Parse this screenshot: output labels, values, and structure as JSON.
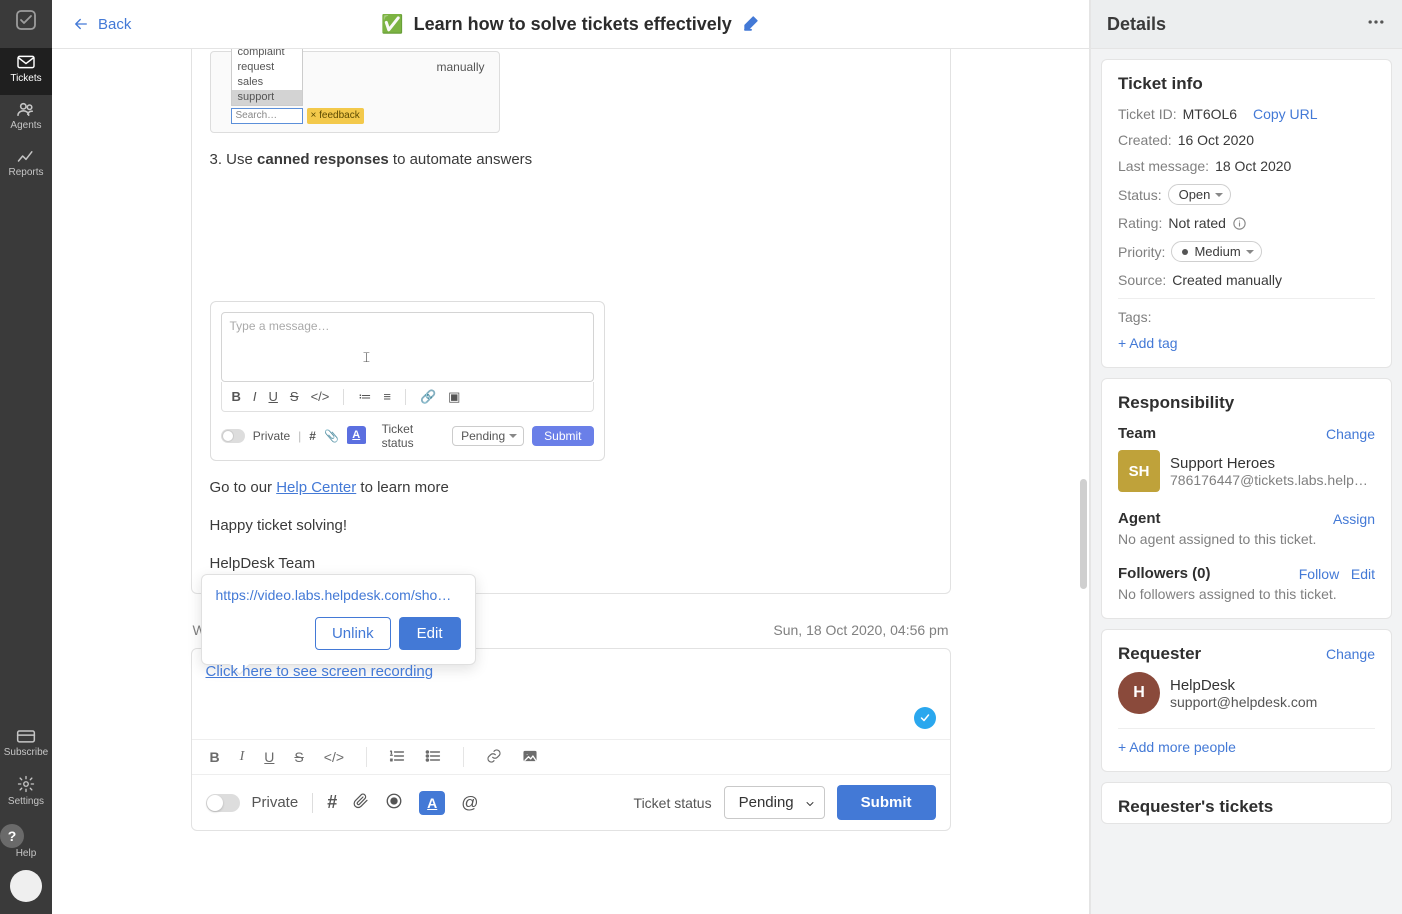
{
  "sidebar": {
    "items": [
      {
        "label": "Tickets"
      },
      {
        "label": "Agents"
      },
      {
        "label": "Reports"
      }
    ],
    "bottom": [
      {
        "label": "Subscribe"
      },
      {
        "label": "Settings"
      },
      {
        "label": "Help"
      }
    ]
  },
  "topbar": {
    "back": "Back",
    "title_emoji": "✅",
    "title": "Learn how to solve tickets effectively"
  },
  "message": {
    "shot1": {
      "opts": [
        "complaint",
        "request",
        "sales",
        "support"
      ],
      "manual": "manually",
      "search_ph": "Search…",
      "tag": "feedback"
    },
    "step3_prefix": "3. Use ",
    "step3_bold": "canned responses",
    "step3_suffix": " to automate answers",
    "shot2": {
      "placeholder": "Type a message…",
      "private": "Private",
      "status_lbl": "Ticket status",
      "status_val": "Pending",
      "submit": "Submit"
    },
    "goto_prefix": "Go to our ",
    "help_center": "Help Center",
    "goto_suffix": " to learn more",
    "happy": "Happy ticket solving!",
    "sig": "HelpDesk Team"
  },
  "meta": {
    "from": "Wer",
    "date": "Sun, 18 Oct 2020, 04:56 pm"
  },
  "popover": {
    "url": "https://video.labs.helpdesk.com/show/...",
    "unlink": "Unlink",
    "edit": "Edit"
  },
  "composer": {
    "link_text": "Click here to see screen recording",
    "private": "Private",
    "status_lbl": "Ticket status",
    "status_val": "Pending",
    "submit": "Submit"
  },
  "details": {
    "header": "Details",
    "info": {
      "title": "Ticket info",
      "id_lbl": "Ticket ID:",
      "id_val": "MT6OL6",
      "copy": "Copy URL",
      "created_lbl": "Created:",
      "created_val": "16 Oct 2020",
      "last_lbl": "Last message:",
      "last_val": "18 Oct 2020",
      "status_lbl": "Status:",
      "status_val": "Open",
      "rating_lbl": "Rating:",
      "rating_val": "Not rated",
      "priority_lbl": "Priority:",
      "priority_val": "Medium",
      "source_lbl": "Source:",
      "source_val": "Created manually",
      "tags_lbl": "Tags:",
      "add_tag": "+ Add tag"
    },
    "resp": {
      "title": "Responsibility",
      "team_lbl": "Team",
      "change": "Change",
      "team_initials": "SH",
      "team_name": "Support Heroes",
      "team_email": "786176447@tickets.labs.helpde…",
      "agent_lbl": "Agent",
      "assign": "Assign",
      "agent_none": "No agent assigned to this ticket.",
      "followers_lbl": "Followers (0)",
      "follow": "Follow",
      "edit": "Edit",
      "followers_none": "No followers assigned to this ticket."
    },
    "req": {
      "title": "Requester",
      "change": "Change",
      "initial": "H",
      "name": "HelpDesk",
      "email": "support@helpdesk.com",
      "add_more": "+ Add more people"
    },
    "req_tickets_title": "Requester's tickets"
  }
}
